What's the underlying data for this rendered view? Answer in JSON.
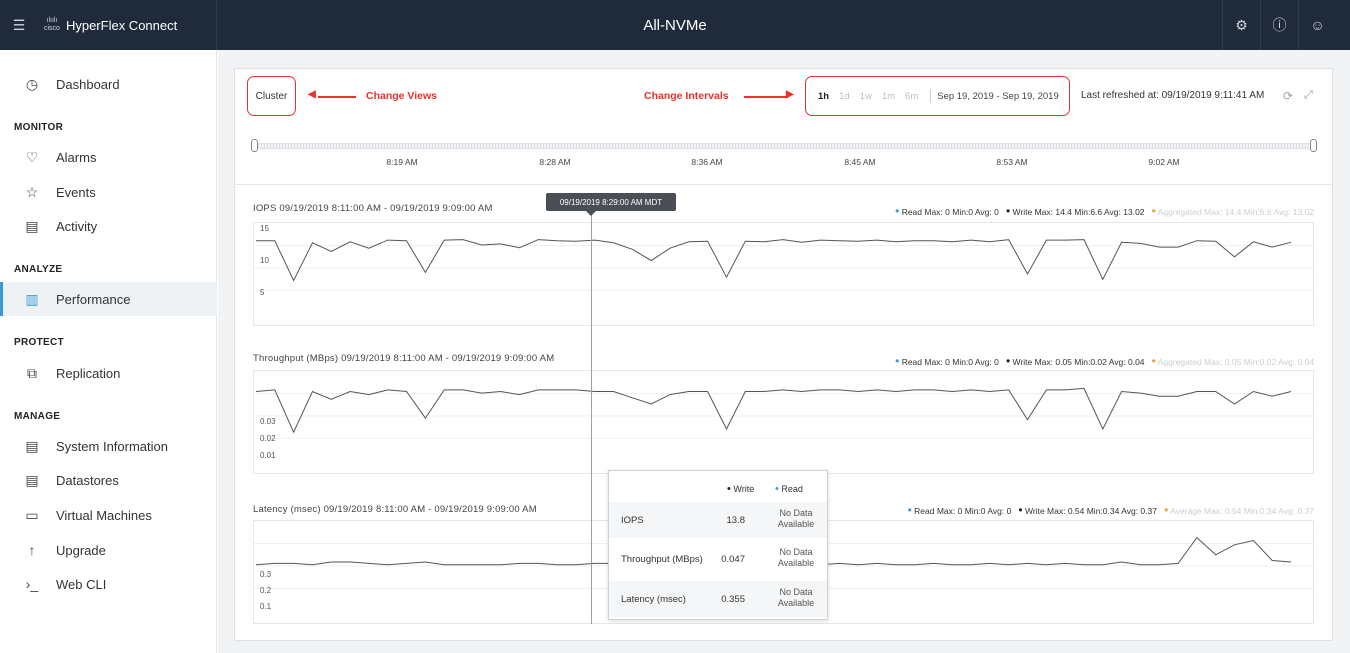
{
  "header": {
    "brand": "HyperFlex Connect",
    "logo": "cisco",
    "title": "All-NVMe",
    "icons": [
      "menu-icon",
      "settings-icon",
      "help-icon",
      "user-icon"
    ]
  },
  "sidebar": {
    "dashboard": "Dashboard",
    "sections": {
      "monitor": "MONITOR",
      "analyze": "ANALYZE",
      "protect": "PROTECT",
      "manage": "MANAGE"
    },
    "items": {
      "alarms": "Alarms",
      "events": "Events",
      "activity": "Activity",
      "performance": "Performance",
      "replication": "Replication",
      "system_information": "System Information",
      "datastores": "Datastores",
      "virtual_machines": "Virtual Machines",
      "upgrade": "Upgrade",
      "web_cli": "Web CLI"
    }
  },
  "toolbar": {
    "view_button": "Cluster",
    "annotation_views": "Change Views",
    "annotation_intervals": "Change Intervals",
    "intervals": [
      "1h",
      "1d",
      "1w",
      "1m",
      "6m"
    ],
    "selected_interval": "1h",
    "date_range": "Sep 19, 2019 - Sep 19, 2019",
    "last_refreshed": "Last refreshed at: 09/19/2019 9:11:41 AM"
  },
  "timeline": {
    "ticks": [
      "8:19 AM",
      "8:28 AM",
      "8:36 AM",
      "8:45 AM",
      "8:53 AM",
      "9:02 AM"
    ]
  },
  "hover": {
    "timestamp": "09/19/2019 8:29:00 AM MDT",
    "col_write": "Write",
    "col_read": "Read",
    "rows": [
      {
        "label": "IOPS",
        "write": "13.8",
        "read": "No Data Available"
      },
      {
        "label": "Throughput (MBps)",
        "write": "0.047",
        "read": "No Data Available"
      },
      {
        "label": "Latency (msec)",
        "write": "0.355",
        "read": "No Data Available"
      }
    ]
  },
  "colors": {
    "accent": "#3a9ad9",
    "annotation": "#e8322d",
    "read": "#3a9ad9",
    "write": "#222222",
    "aggregated": "#f0a030",
    "header_bg": "#1f2b3a"
  },
  "chart_data": [
    {
      "type": "line",
      "title": "IOPS 09/19/2019 8:11:00 AM - 09/19/2019 9:09:00 AM",
      "legend": {
        "read": "Read Max: 0 Min:0 Avg: 0",
        "write": "Write Max: 14.4 Min:6.6 Avg: 13.02",
        "aggregated": "Aggregated Max: 14.4 Min:6.6 Avg: 13.02"
      },
      "yticks": [
        "15",
        "10",
        "5"
      ],
      "ylim": [
        0,
        16
      ],
      "series": [
        {
          "name": "Write",
          "values": [
            14.2,
            14.2,
            6.8,
            13.8,
            12.2,
            14.0,
            12.8,
            14.3,
            14.2,
            8.3,
            14.3,
            14.4,
            13.4,
            13.6,
            12.9,
            14.4,
            14.2,
            14.1,
            14.3,
            13.8,
            12.6,
            10.5,
            12.8,
            14.0,
            14.1,
            7.4,
            14.1,
            14.0,
            14.4,
            13.9,
            14.3,
            14.2,
            14.1,
            14.3,
            14.0,
            14.2,
            14.2,
            14.0,
            14.3,
            14.0,
            14.4,
            8.0,
            14.3,
            14.3,
            14.4,
            7.0,
            13.9,
            13.7,
            13.0,
            13.0,
            14.2,
            14.1,
            11.2,
            14.0,
            13.0,
            13.9
          ]
        }
      ]
    },
    {
      "type": "line",
      "title": "Throughput (MBps) 09/19/2019 8:11:00 AM - 09/19/2019 9:09:00 AM",
      "legend": {
        "read": "Read Max: 0 Min:0 Avg: 0",
        "write": "Write Max: 0.05 Min:0.02 Avg: 0.04",
        "aggregated": "Aggregated Max: 0.05 Min:0.02 Avg: 0.04"
      },
      "yticks": [
        "0.03",
        "0.02",
        "0.01"
      ],
      "ylim": [
        0,
        0.055
      ],
      "series": [
        {
          "name": "Write",
          "values": [
            0.047,
            0.048,
            0.021,
            0.047,
            0.042,
            0.047,
            0.045,
            0.048,
            0.047,
            0.03,
            0.048,
            0.048,
            0.046,
            0.047,
            0.045,
            0.048,
            0.048,
            0.048,
            0.047,
            0.047,
            0.043,
            0.039,
            0.045,
            0.047,
            0.047,
            0.023,
            0.047,
            0.047,
            0.048,
            0.047,
            0.048,
            0.048,
            0.047,
            0.048,
            0.047,
            0.048,
            0.048,
            0.047,
            0.048,
            0.047,
            0.048,
            0.029,
            0.048,
            0.048,
            0.049,
            0.023,
            0.047,
            0.046,
            0.044,
            0.044,
            0.047,
            0.047,
            0.039,
            0.047,
            0.044,
            0.047
          ]
        }
      ]
    },
    {
      "type": "line",
      "title": "Latency (msec) 09/19/2019 8:11:00 AM - 09/19/2019 9:09:00 AM",
      "legend": {
        "read": "Read Max: 0 Min:0 Avg: 0",
        "write": "Write Max: 0.54 Min:0.34 Avg: 0.37",
        "aggregated": "Average Max: 0.54 Min:0.34 Avg: 0.37"
      },
      "yticks": [
        "0.3",
        "0.2",
        "0.1"
      ],
      "ylim": [
        0,
        0.6
      ],
      "series": [
        {
          "name": "Write",
          "values": [
            0.35,
            0.36,
            0.36,
            0.35,
            0.37,
            0.37,
            0.36,
            0.35,
            0.36,
            0.37,
            0.35,
            0.35,
            0.35,
            0.35,
            0.36,
            0.36,
            0.35,
            0.35,
            0.36,
            0.36,
            0.35,
            0.35,
            0.35,
            0.36,
            0.36,
            0.35,
            0.36,
            0.35,
            0.35,
            0.36,
            0.35,
            0.36,
            0.35,
            0.36,
            0.35,
            0.35,
            0.36,
            0.35,
            0.35,
            0.36,
            0.35,
            0.36,
            0.35,
            0.36,
            0.35,
            0.35,
            0.37,
            0.35,
            0.35,
            0.36,
            0.54,
            0.42,
            0.49,
            0.52,
            0.38,
            0.37
          ]
        }
      ]
    }
  ]
}
